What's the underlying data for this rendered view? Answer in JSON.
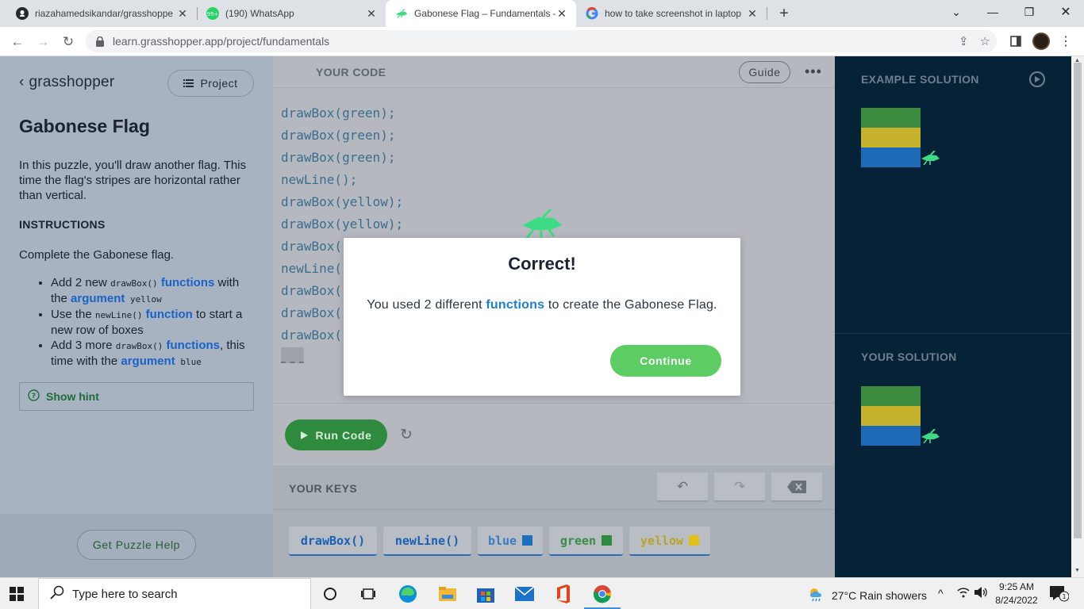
{
  "browser": {
    "tabs": [
      {
        "label": "riazahamedsikandar/grasshoppe",
        "icon": "github-icon"
      },
      {
        "label": "(190) WhatsApp",
        "icon": "whatsapp-icon",
        "badge": "99+"
      },
      {
        "label": "Gabonese Flag – Fundamentals –",
        "icon": "grasshopper-icon"
      },
      {
        "label": "how to take screenshot in laptop",
        "icon": "google-icon"
      }
    ],
    "url": "learn.grasshopper.app/project/fundamentals"
  },
  "sidebar": {
    "brand": "grasshopper",
    "project_label": "Project",
    "puzzle_title": "Gabonese Flag",
    "intro": "In this puzzle, you'll draw another flag. This time the flag's stripes are horizontal rather than vertical.",
    "instructions_heading": "INSTRUCTIONS",
    "instructions_text": "Complete the Gabonese flag.",
    "bullets": {
      "b1": {
        "t1": "Add 2 new ",
        "c1": "drawBox()",
        "k1": "functions",
        "t2": " with the ",
        "k2": "argument",
        "c2": " yellow"
      },
      "b2": {
        "t1": "Use the ",
        "c1": "newLine()",
        "k1": "function",
        "t2": " to start a new row of boxes"
      },
      "b3": {
        "t1": "Add 3 more ",
        "c1": "drawBox()",
        "k1": "functions",
        "t2": ", this time with the ",
        "k2": "argument",
        "c2": " blue"
      }
    },
    "hint_label": "Show hint",
    "help_label": "Get Puzzle Help"
  },
  "editor": {
    "heading": "YOUR CODE",
    "guide_label": "Guide",
    "more_label": "•••",
    "lines": [
      "drawBox(green);",
      "drawBox(green);",
      "drawBox(green);",
      "newLine();",
      "drawBox(yellow);",
      "drawBox(yellow);",
      "drawBox(",
      "newLine(",
      "drawBox(",
      "drawBox(",
      "drawBox("
    ],
    "run_label": "Run Code"
  },
  "keys": {
    "heading": "YOUR KEYS",
    "items": [
      {
        "label": "drawBox()",
        "color": "#1b5fb5"
      },
      {
        "label": "newLine()",
        "color": "#1b5fb5"
      },
      {
        "label": "blue",
        "color": "#3a7bc4",
        "swatch": "#1e6fc0"
      },
      {
        "label": "green",
        "color": "#3d8a4a",
        "swatch": "#2e8b3e"
      },
      {
        "label": "yellow",
        "color": "#b8a42b",
        "swatch": "#e3c019"
      }
    ]
  },
  "solution": {
    "example_heading": "EXAMPLE SOLUTION",
    "your_heading": "YOUR SOLUTION",
    "flag_colors": [
      "#3b8a3d",
      "#c7b22e",
      "#1c6ab5"
    ]
  },
  "modal": {
    "title": "Correct!",
    "msg_pre": "You used 2 different ",
    "msg_kw": "functions",
    "msg_post": " to create the Gabonese Flag.",
    "continue_label": "Continue"
  },
  "taskbar": {
    "search_placeholder": "Type here to search",
    "weather": "27°C  Rain showers",
    "time": "9:25 AM",
    "date": "8/24/2022",
    "notif_count": "1"
  },
  "colors": {
    "accent_green": "#5ccd62",
    "keyword_blue": "#1b7fd8",
    "dark_panel": "#062236"
  }
}
